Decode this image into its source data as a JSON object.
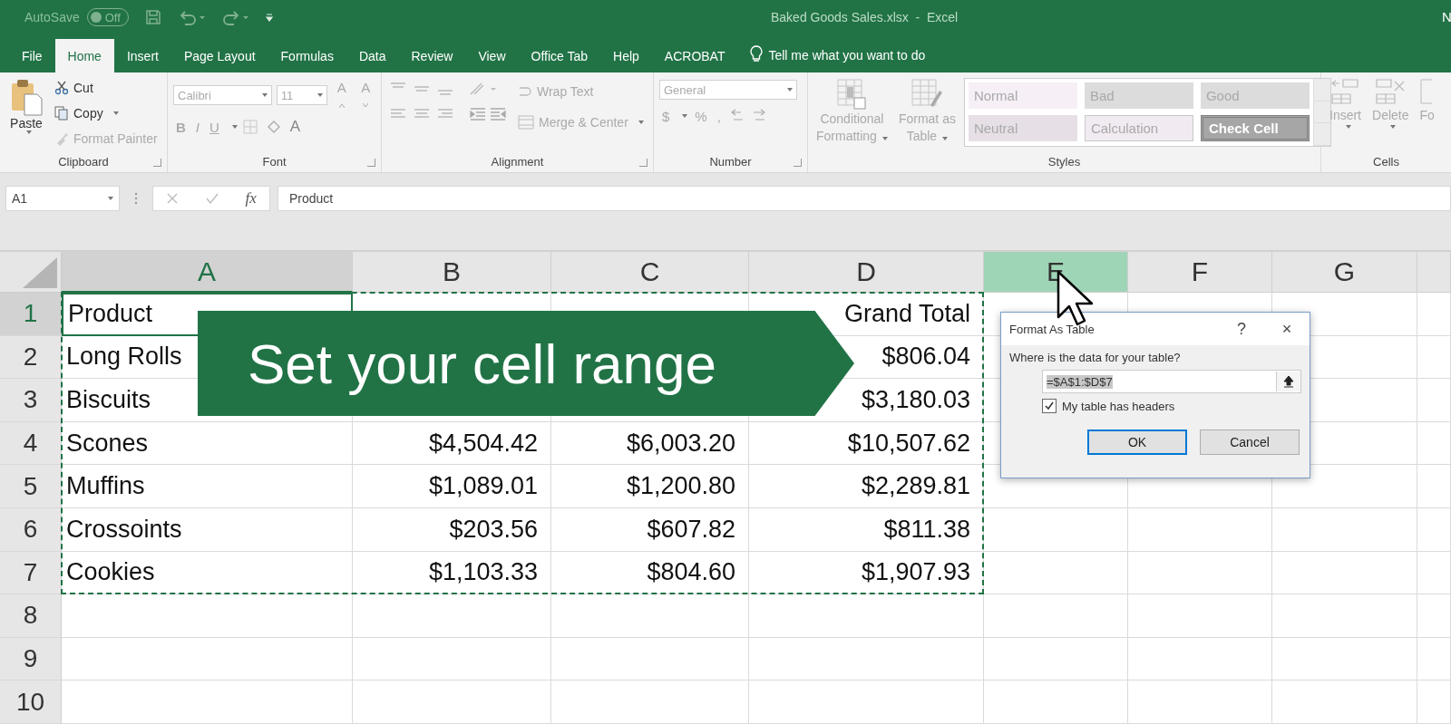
{
  "title_bar": {
    "autosave_label": "AutoSave",
    "autosave_toggle": {
      "label": "Off",
      "on": false
    },
    "title": "Baked Goods Sales.xlsx  -  Excel",
    "user_initial": "N"
  },
  "tabs": [
    {
      "label": "File",
      "selected": false
    },
    {
      "label": "Home",
      "selected": true
    },
    {
      "label": "Insert",
      "selected": false
    },
    {
      "label": "Page Layout",
      "selected": false
    },
    {
      "label": "Formulas",
      "selected": false
    },
    {
      "label": "Data",
      "selected": false
    },
    {
      "label": "Review",
      "selected": false
    },
    {
      "label": "View",
      "selected": false
    },
    {
      "label": "Office Tab",
      "selected": false
    },
    {
      "label": "Help",
      "selected": false
    },
    {
      "label": "ACROBAT",
      "selected": false
    }
  ],
  "tell_me": "Tell me what you want to do",
  "ribbon": {
    "clipboard": {
      "paste": "Paste",
      "cut": "Cut",
      "copy": "Copy",
      "format_painter": "Format Painter",
      "label": "Clipboard"
    },
    "font": {
      "name": "Calibri",
      "size": "11",
      "grow": "A",
      "shrink": "A",
      "bold": "B",
      "italic": "I",
      "underline": "U",
      "font_color": "A",
      "label": "Font"
    },
    "alignment": {
      "wrap": "Wrap Text",
      "merge": "Merge & Center",
      "label": "Alignment"
    },
    "number": {
      "format": "General",
      "currency": "$",
      "percent": "%",
      "comma": ",",
      "label": "Number"
    },
    "styles": {
      "conditional": [
        "Conditional",
        "Formatting"
      ],
      "format_table": [
        "Format as",
        "Table"
      ],
      "label": "Styles",
      "gallery": [
        {
          "label": "Normal",
          "kind": "plain",
          "color": "#f6eff6"
        },
        {
          "label": "Bad",
          "kind": "plain",
          "color": "#dcdcdc"
        },
        {
          "label": "Good",
          "kind": "plain",
          "color": "#dcdcdc"
        },
        {
          "label": "Neutral",
          "kind": "plain",
          "color": "#e6e0e6"
        },
        {
          "label": "Calculation",
          "kind": "boxed",
          "color": "#f1ebf1"
        },
        {
          "label": "Check Cell",
          "kind": "check",
          "color": "#a6a6a6"
        }
      ]
    },
    "cells": {
      "insert": "Insert",
      "delete": "Delete",
      "format": "Fo",
      "label": "Cells"
    }
  },
  "formula_bar": {
    "name_box": "A1",
    "fx": "fx",
    "value": "Product"
  },
  "grid": {
    "columns": [
      {
        "letter": "A",
        "active": true,
        "selected": false
      },
      {
        "letter": "B",
        "active": false,
        "selected": false
      },
      {
        "letter": "C",
        "active": false,
        "selected": false
      },
      {
        "letter": "D",
        "active": false,
        "selected": false
      },
      {
        "letter": "E",
        "active": false,
        "selected": true
      },
      {
        "letter": "F",
        "active": false,
        "selected": false
      },
      {
        "letter": "G",
        "active": false,
        "selected": false
      }
    ],
    "rows": [
      {
        "number": "1",
        "active": true,
        "cells": {
          "a": "Product",
          "d": "Grand Total"
        }
      },
      {
        "number": "2",
        "active": false,
        "cells": {
          "a": "Long Rolls",
          "d": "$806.04"
        }
      },
      {
        "number": "3",
        "active": false,
        "cells": {
          "a": "Biscuits",
          "d": "$3,180.03"
        }
      },
      {
        "number": "4",
        "active": false,
        "cells": {
          "a": "Scones",
          "b": "$4,504.42",
          "c": "$6,003.20",
          "d": "$10,507.62"
        }
      },
      {
        "number": "5",
        "active": false,
        "cells": {
          "a": "Muffins",
          "b": "$1,089.01",
          "c": "$1,200.80",
          "d": "$2,289.81"
        }
      },
      {
        "number": "6",
        "active": false,
        "cells": {
          "a": "Crossoints",
          "b": "$203.56",
          "c": "$607.82",
          "d": "$811.38"
        }
      },
      {
        "number": "7",
        "active": false,
        "cells": {
          "a": "Cookies",
          "b": "$1,103.33",
          "c": "$804.60",
          "d": "$1,907.93"
        }
      },
      {
        "number": "8",
        "active": false,
        "cells": {}
      },
      {
        "number": "9",
        "active": false,
        "cells": {}
      },
      {
        "number": "10",
        "active": false,
        "cells": {}
      }
    ]
  },
  "banner": "Set your cell range",
  "dialog": {
    "title": "Format As Table",
    "help": "?",
    "close": "×",
    "question": "Where is the data for your table?",
    "range": "=$A$1:$D$7",
    "headers": {
      "label": "My table has headers",
      "checked": true
    },
    "buttons": [
      {
        "label": "OK",
        "kind": "default"
      },
      {
        "label": "Cancel",
        "kind": "normal"
      }
    ]
  }
}
